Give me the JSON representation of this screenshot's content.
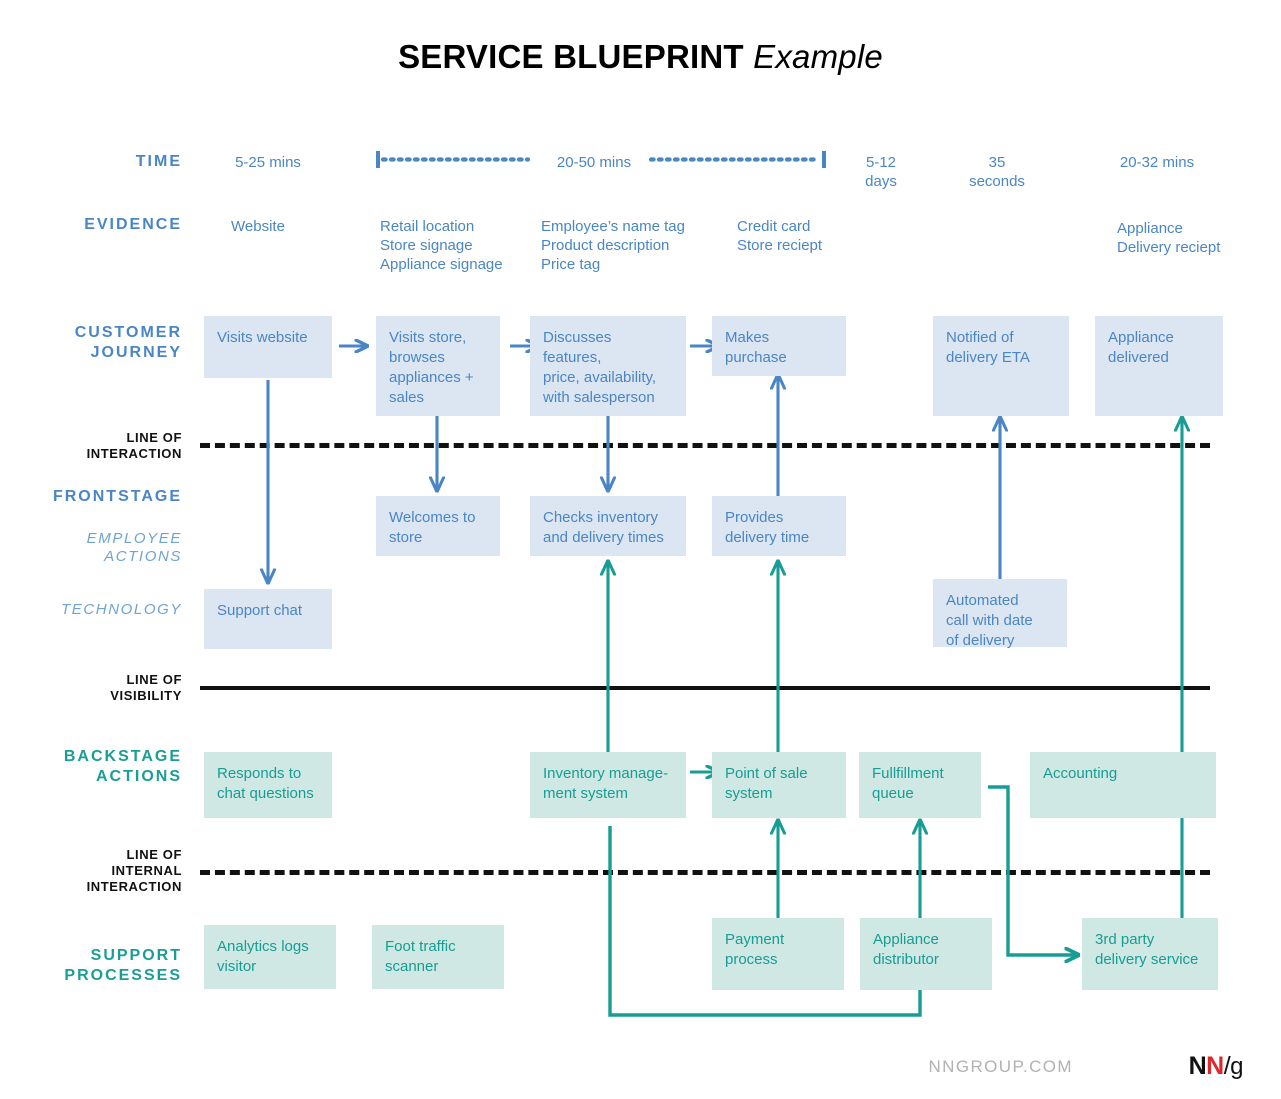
{
  "title": {
    "bold": "SERVICE BLUEPRINT",
    "italic": "Example"
  },
  "colors": {
    "blue_accent": "#4a86c5",
    "blue_box_fill": "#dce6f2",
    "teal_accent": "#179d93",
    "teal_box_fill": "#cfe8e4",
    "line_black": "#111111",
    "footer_gray": "#b2b2b2",
    "logo_red": "#e0262b"
  },
  "row_labels": {
    "time": "TIME",
    "evidence": "EVIDENCE",
    "customer_journey": "CUSTOMER\nJOURNEY",
    "line_of_interaction": "LINE OF\nINTERACTION",
    "frontstage": "FRONTSTAGE",
    "employee_actions": "EMPLOYEE\nACTIONS",
    "technology": "TECHNOLOGY",
    "line_of_visibility": "LINE OF\nVISIBILITY",
    "backstage_actions": "BACKSTAGE\nACTIONS",
    "line_of_internal_interaction": "LINE OF\nINTERNAL\nINTERACTION",
    "support_processes": "SUPPORT\nPROCESSES"
  },
  "time": {
    "items": [
      {
        "label": "5-25 mins"
      },
      {
        "label": "20-50 mins"
      },
      {
        "label": "5-12\ndays"
      },
      {
        "label": "35\nseconds"
      },
      {
        "label": "20-32 mins"
      }
    ]
  },
  "evidence": {
    "items": [
      {
        "label": "Website"
      },
      {
        "label": "Retail location\nStore signage\nAppliance signage"
      },
      {
        "label": "Employee’s name tag\nProduct description\nPrice tag"
      },
      {
        "label": "Credit card\nStore reciept"
      },
      {
        "label": "Appliance\nDelivery reciept"
      }
    ]
  },
  "customer_journey": {
    "boxes": [
      {
        "label": "Visits website"
      },
      {
        "label": "Visits store,\nbrowses\nappliances +\nsales"
      },
      {
        "label": "Discusses features,\nprice, availability,\nwith salesperson"
      },
      {
        "label": "Makes purchase"
      },
      {
        "label": "Notified of\ndelivery ETA"
      },
      {
        "label": "Appliance\ndelivered"
      }
    ]
  },
  "frontstage": {
    "employee_actions": [
      {
        "label": "Welcomes to\nstore"
      },
      {
        "label": "Checks inventory\nand delivery times"
      },
      {
        "label": "Provides\ndelivery time"
      }
    ],
    "technology": [
      {
        "label": "Support chat"
      },
      {
        "label": "Automated\ncall with date\nof delivery"
      }
    ]
  },
  "backstage_actions": {
    "boxes": [
      {
        "label": "Responds to\nchat questions"
      },
      {
        "label": "Inventory manage-\nment system"
      },
      {
        "label": "Point of sale\nsystem"
      },
      {
        "label": "Fullfillment\nqueue"
      },
      {
        "label": "Accounting"
      }
    ]
  },
  "support_processes": {
    "boxes": [
      {
        "label": "Analytics logs\nvisitor"
      },
      {
        "label": "Foot traffic\nscanner"
      },
      {
        "label": "Payment\nprocess"
      },
      {
        "label": "Appliance\ndistributor"
      },
      {
        "label": "3rd party\ndelivery service"
      }
    ]
  },
  "footer": {
    "url": "NNGROUP.COM",
    "logo_n1": "N",
    "logo_n2": "N",
    "logo_slash": "/",
    "logo_g": "g"
  }
}
